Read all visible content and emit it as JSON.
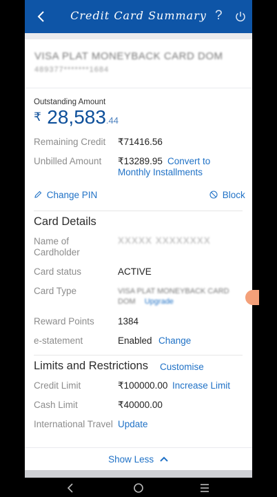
{
  "appbar": {
    "title": "Credit Card Summary",
    "help": "?"
  },
  "card": {
    "name": "VISA PLAT MONEYBACK CARD DOM",
    "number": "489377*******1684"
  },
  "outstanding": {
    "label": "Outstanding Amount",
    "currency": "₹",
    "main": "28,583",
    "decimals": ".44"
  },
  "remaining": {
    "label": "Remaining Credit",
    "value": "₹71416.56"
  },
  "unbilled": {
    "label": "Unbilled Amount",
    "value": "₹13289.95",
    "link_line1": "Convert to",
    "link_line2": "Monthly Installments"
  },
  "actions": {
    "change_pin": "Change PIN",
    "block": "Block"
  },
  "card_details": {
    "title": "Card Details",
    "name_label_1": "Name of",
    "name_label_2": "Cardholder",
    "name_value": "XXXXX XXXXXXXX",
    "status_label": "Card status",
    "status_value": "ACTIVE",
    "type_label": "Card Type",
    "type_value_1": "VISA PLAT MONEYBACK CARD",
    "type_value_2": "DOM",
    "type_upgrade": "Upgrade",
    "reward_label": "Reward Points",
    "reward_value": "1384",
    "estatement_label": "e-statement",
    "estatement_value": "Enabled",
    "estatement_link": "Change"
  },
  "limits": {
    "title": "Limits and Restrictions",
    "customise": "Customise",
    "credit_label": "Credit Limit",
    "credit_value": "₹100000.00",
    "credit_link": "Increase Limit",
    "cash_label": "Cash Limit",
    "cash_value": "₹40000.00",
    "intl_label": "International Travel",
    "intl_link": "Update"
  },
  "footer": {
    "show_less": "Show Less"
  },
  "colors": {
    "primary": "#0e55a7",
    "link": "#1f71c6",
    "amount": "#0d4f9a"
  }
}
